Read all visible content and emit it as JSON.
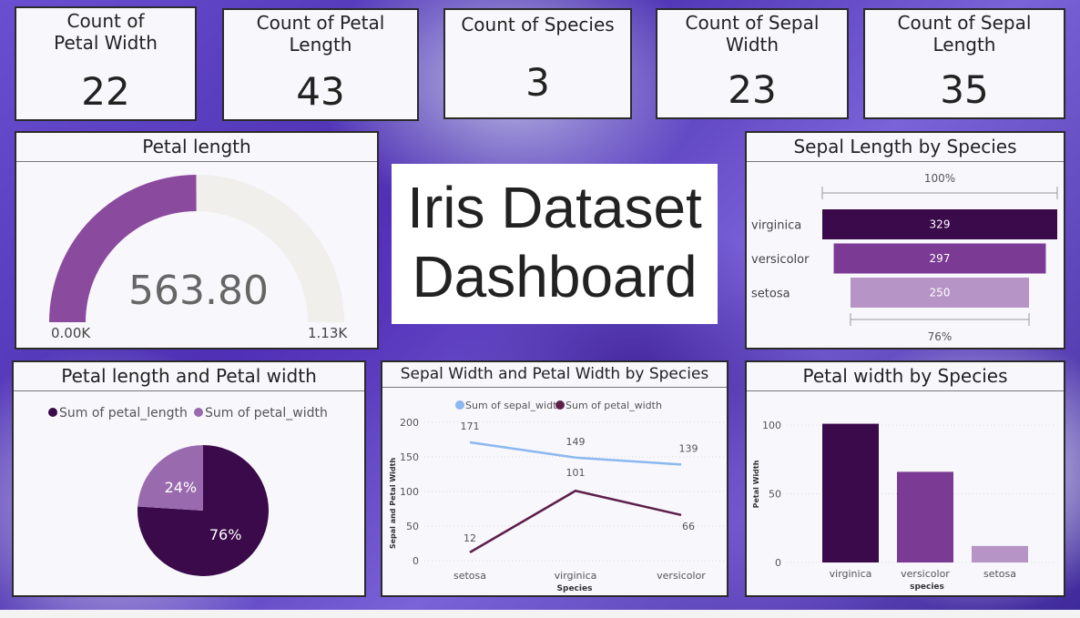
{
  "kpis": [
    {
      "title": "Count of Petal Width",
      "value": "22"
    },
    {
      "title": "Count of Petal Length",
      "value": "43"
    },
    {
      "title": "Count of Species",
      "value": "3"
    },
    {
      "title": "Count of Sepal Width",
      "value": "23"
    },
    {
      "title": "Count of Sepal Length",
      "value": "35"
    }
  ],
  "headline": {
    "line1": "Iris Dataset",
    "line2": "Dashboard"
  },
  "colors": {
    "dark_purple": "#3a0a4a",
    "mid_purple": "#7b3a93",
    "light_purple": "#b694c6",
    "gauge_fill": "#8a4a9e",
    "gauge_track": "#f0efec",
    "line_blue": "#8ab8f0",
    "line_maroon": "#5c1f4a"
  },
  "chart_data": [
    {
      "type": "gauge",
      "title": "Petal length",
      "value": 563.8,
      "value_label": "563.80",
      "min": 0,
      "max": 1130,
      "min_label": "0.00K",
      "max_label": "1.13K"
    },
    {
      "type": "funnel",
      "title": "Sepal Length by Species",
      "categories": [
        "virginica",
        "versicolor",
        "setosa"
      ],
      "values": [
        329,
        297,
        250
      ],
      "top_label": "100%",
      "bottom_label": "76%"
    },
    {
      "type": "pie",
      "title": "Petal length and Petal width",
      "legend": [
        "Sum of petal_length",
        "Sum of petal_width"
      ],
      "values": [
        76,
        24
      ],
      "labels": [
        "76%",
        "24%"
      ]
    },
    {
      "type": "line",
      "title": "Sepal Width and Petal Width by Species",
      "categories": [
        "setosa",
        "virginica",
        "versicolor"
      ],
      "xlabel": "Species",
      "ylabel": "Sepal and Petal Width",
      "ylim": [
        0,
        200
      ],
      "yticks": [
        "0",
        "50",
        "100",
        "150",
        "200"
      ],
      "series": [
        {
          "name": "Sum of sepal_width",
          "values": [
            171,
            149,
            139
          ]
        },
        {
          "name": "Sum of petal_width",
          "values": [
            12,
            101,
            66
          ]
        }
      ]
    },
    {
      "type": "bar",
      "title": "Petal width by Species",
      "categories": [
        "virginica",
        "versicolor",
        "setosa"
      ],
      "values": [
        101,
        66,
        12
      ],
      "xlabel": "species",
      "ylabel": "Petal Width",
      "ylim": [
        0,
        110
      ],
      "yticks": [
        "0",
        "50",
        "100"
      ]
    }
  ]
}
